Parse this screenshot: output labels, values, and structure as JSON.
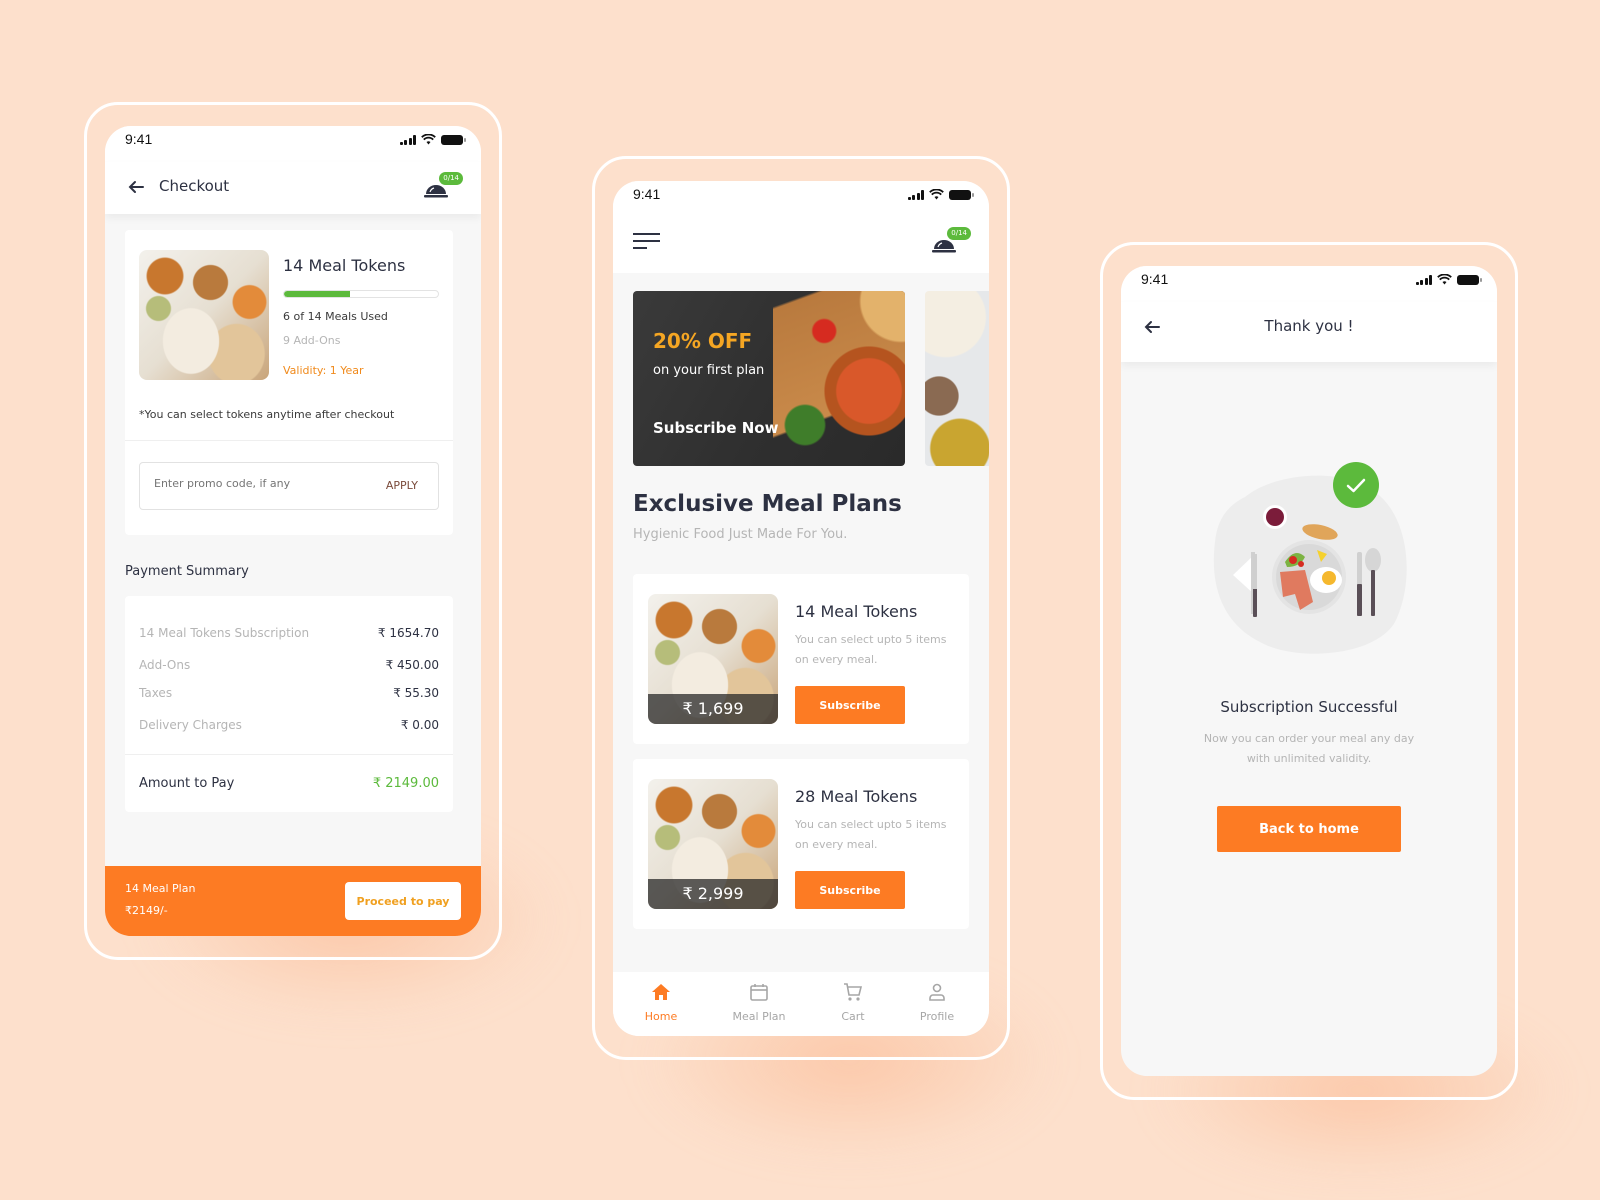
{
  "colors": {
    "background": "#fde0cc",
    "accent_orange": "#fd7b23",
    "success_green": "#5cba3c",
    "text_dark": "#2d3142",
    "text_muted": "#b5b5b5"
  },
  "status_bar": {
    "time": "9:41"
  },
  "cart_badge": "0/14",
  "checkout": {
    "title": "Checkout",
    "plan": {
      "name": "14 Meal Tokens",
      "meals_used": 6,
      "meals_total": 14,
      "progress_fraction": 0.43,
      "usage_text": "6 of 14 Meals Used",
      "addons": "9 Add-Ons",
      "validity": "Validity: 1 Year"
    },
    "note": "*You can select tokens anytime after checkout",
    "promo": {
      "placeholder": "Enter promo code, if any",
      "value": "",
      "apply_label": "APPLY"
    },
    "payment_summary": {
      "heading": "Payment Summary",
      "rows": [
        {
          "label": "14 Meal Tokens Subscription",
          "value": "₹ 1654.70"
        },
        {
          "label": "Add-Ons",
          "value": "₹ 450.00"
        },
        {
          "label": "Taxes",
          "value": "₹ 55.30"
        },
        {
          "label": "Delivery Charges",
          "value": "₹ 0.00"
        }
      ],
      "total_label": "Amount to Pay",
      "total_value": "₹ 2149.00"
    },
    "footer": {
      "plan_label": "14 Meal Plan",
      "price": "₹2149/-",
      "proceed_label": "Proceed to pay"
    }
  },
  "home": {
    "banner": {
      "discount": "20% OFF",
      "subtitle": "on your first plan",
      "cta": "Subscribe Now"
    },
    "section_title": "Exclusive Meal Plans",
    "section_subtitle": "Hygienic Food Just Made For You.",
    "plans": [
      {
        "name": "14 Meal Tokens",
        "description": "You can select upto 5 items on every meal.",
        "price": "₹ 1,699",
        "button": "Subscribe"
      },
      {
        "name": "28 Meal Tokens",
        "description": "You can select upto 5 items on every meal.",
        "price": "₹ 2,999",
        "button": "Subscribe"
      }
    ],
    "tabs": [
      {
        "label": "Home",
        "icon": "home-icon",
        "active": true
      },
      {
        "label": "Meal Plan",
        "icon": "calendar-icon",
        "active": false
      },
      {
        "label": "Cart",
        "icon": "cart-icon",
        "active": false
      },
      {
        "label": "Profile",
        "icon": "profile-icon",
        "active": false
      }
    ]
  },
  "thankyou": {
    "title": "Thank you !",
    "heading": "Subscription Successful",
    "message_line1": "Now you can order your meal any day",
    "message_line2": "with unlimited validity.",
    "button": "Back to home"
  }
}
